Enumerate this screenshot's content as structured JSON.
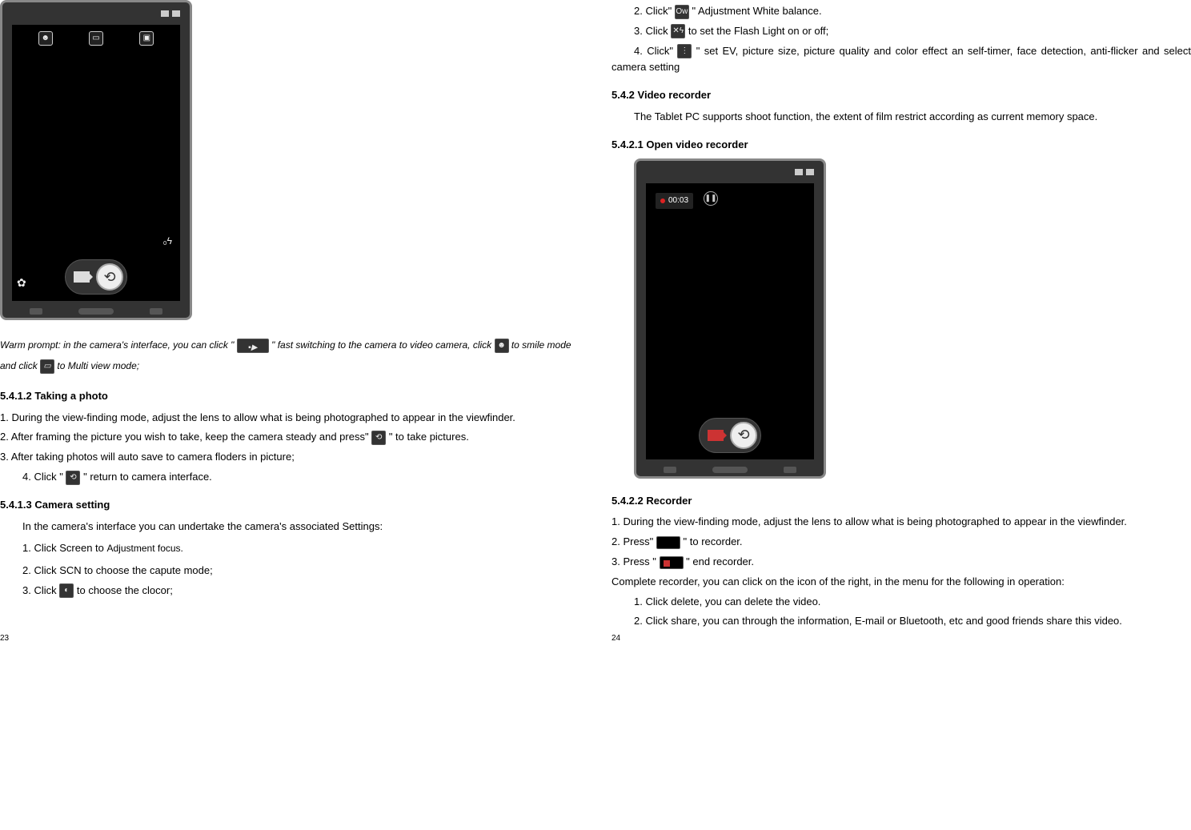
{
  "left": {
    "warm_a": "Warm prompt: in the camera's interface, you can click \"",
    "warm_b": "\" fast switching to the camera to video camera, click ",
    "warm_c": " to smile mode and click ",
    "warm_d": " to Multi view mode;",
    "h5412": "5.4.1.2    Taking a photo",
    "p1": "1. During the view-finding mode, adjust the lens to allow what is being photographed to appear in the viewfinder.",
    "p2a": "2. After framing the picture you wish to take, keep the camera steady and press\" ",
    "p2b": " \" to take pictures.",
    "p3": "3. After taking photos will auto save to camera floders in picture;",
    "p4a": "4. Click \"",
    "p4b": "\" return to camera interface.",
    "h5413": "5.4.1.3    Camera setting",
    "cs1": "In the camera's interface you can undertake the camera's associated Settings:",
    "cs2a": "1. Click Screen to ",
    "cs2b": "Adjustment focus.",
    "cs3": "2. Click SCN to choose the capute mode;",
    "cs4a": "3. Click ",
    "cs4b": " to choose the clocor;",
    "pagenum": "23"
  },
  "right": {
    "r2a": "2. Click\"",
    "r2b": "\" Adjustment White balance.",
    "r3a": "3. Click ",
    "r3b": " to set the Flash Light on or off;",
    "r4a": "4. Click\"",
    "r4b": "\" set EV,    picture size, picture quality and color effect    an self-timer, face detection, anti-flicker and select camera setting",
    "h542": "5.4.2    Video recorder",
    "vr1": "The Tablet PC supports shoot function, the extent of film restrict according as current memory space.",
    "h5421": "5.4.2.1    Open video recorder",
    "rectime": "00:03",
    "h5422": "5.4.2.2    Recorder",
    "rc1": "1. During the view-finding mode, adjust the lens to allow what is being photographed to appear in the viewfinder.",
    "rc2a": "2. Press\" ",
    "rc2b": " \" to recorder.",
    "rc3a": "3. Press \"",
    "rc3b": "\" end recorder.",
    "rc4": "Complete recorder, you can click on the icon of the right, in the menu for the following in operation:",
    "rc5": "1. Click delete, you can delete the video.",
    "rc6": "2. Click share, you can through the information, E-mail or Bluetooth, etc and good friends share this video.",
    "pagenum": "24"
  },
  "icons": {
    "ow": "Ow",
    "flash": "✕ϟ",
    "menu": "⋮"
  }
}
